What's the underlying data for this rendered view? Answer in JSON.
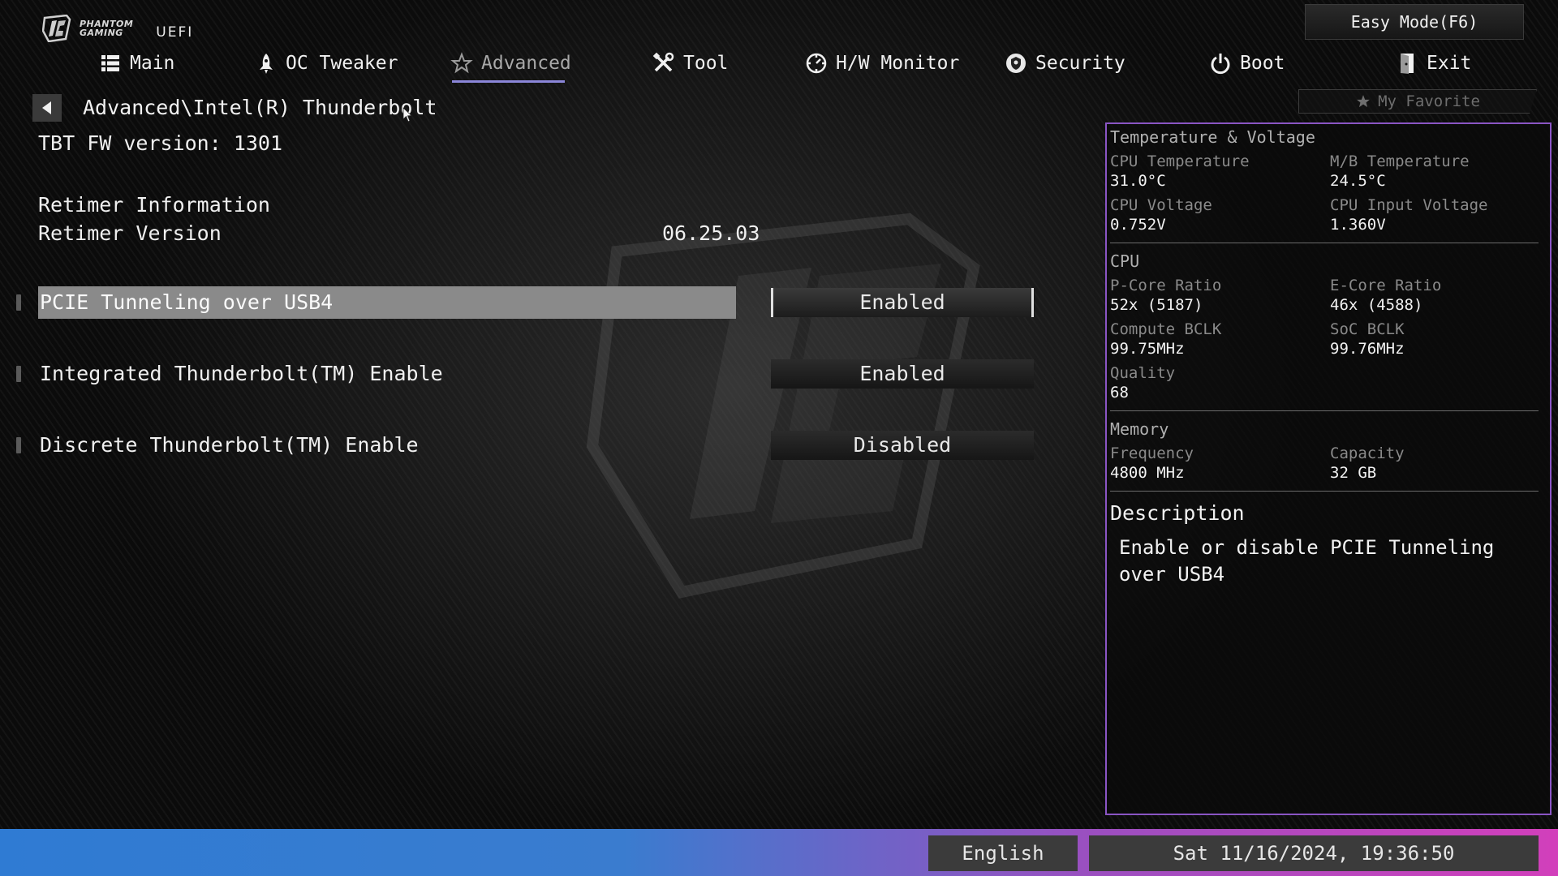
{
  "brand": {
    "name_line1": "PHANTOM",
    "name_line2": "GAMING",
    "product": "UEFI"
  },
  "easy_mode_label": "Easy Mode(F6)",
  "nav": {
    "items": [
      {
        "label": "Main",
        "icon": "list-icon"
      },
      {
        "label": "OC Tweaker",
        "icon": "rocket-icon"
      },
      {
        "label": "Advanced",
        "icon": "star-icon",
        "active": true
      },
      {
        "label": "Tool",
        "icon": "tools-icon"
      },
      {
        "label": "H/W Monitor",
        "icon": "gauge-icon"
      },
      {
        "label": "Security",
        "icon": "shield-icon"
      },
      {
        "label": "Boot",
        "icon": "power-icon"
      },
      {
        "label": "Exit",
        "icon": "exit-door-icon"
      }
    ]
  },
  "favorite_label": "My Favorite",
  "breadcrumb": "Advanced\\Intel(R) Thunderbolt",
  "info": {
    "fw_version": "TBT FW version: 1301",
    "retimer_header": "Retimer Information",
    "retimer_version_label": "Retimer Version",
    "retimer_version_value": "06.25.03"
  },
  "settings": [
    {
      "label": "PCIE Tunneling over USB4",
      "value": "Enabled",
      "selected": true
    },
    {
      "label": "Integrated Thunderbolt(TM) Enable",
      "value": "Enabled"
    },
    {
      "label": "Discrete Thunderbolt(TM) Enable",
      "value": "Disabled"
    }
  ],
  "hw": {
    "temp_section": "Temperature & Voltage",
    "cpu_temp_label": "CPU Temperature",
    "cpu_temp": "31.0°C",
    "mb_temp_label": "M/B Temperature",
    "mb_temp": "24.5°C",
    "cpu_volt_label": "CPU Voltage",
    "cpu_volt": "0.752V",
    "cpu_in_volt_label": "CPU Input Voltage",
    "cpu_in_volt": "1.360V",
    "cpu_section": "CPU",
    "pcore_label": "P-Core Ratio",
    "pcore": "52x (5187)",
    "ecore_label": "E-Core Ratio",
    "ecore": "46x (4588)",
    "bclk_label": "Compute BCLK",
    "bclk": "99.75MHz",
    "soc_label": "SoC BCLK",
    "soc": "99.76MHz",
    "quality_label": "Quality",
    "quality": "68",
    "mem_section": "Memory",
    "freq_label": "Frequency",
    "freq": "4800 MHz",
    "cap_label": "Capacity",
    "cap": "32 GB"
  },
  "description": {
    "title": "Description",
    "text": "Enable or disable PCIE Tunneling over USB4"
  },
  "footer": {
    "language": "English",
    "datetime": "Sat 11/16/2024, 19:36:50"
  },
  "colors": {
    "accent_underline": "#8b86d9",
    "panel_border": "#8a55c4",
    "bottom_gradient_start": "#2f7bd3",
    "bottom_gradient_end": "#d23fbb",
    "selected_row": "#8a8a8a"
  }
}
